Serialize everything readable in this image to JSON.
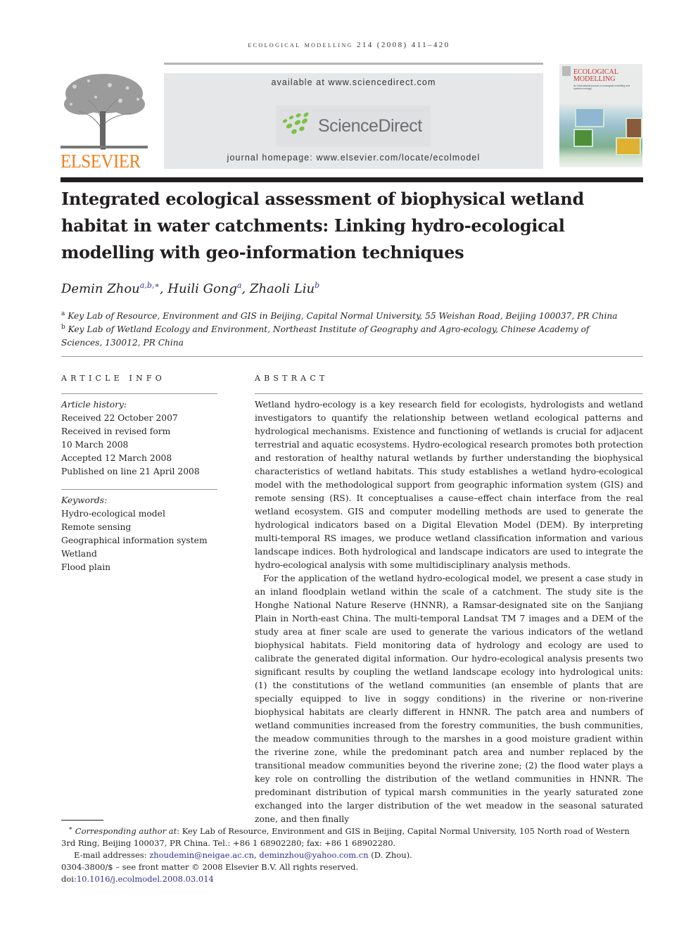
{
  "running_head": "ecological modelling 214 (2008) 411–420",
  "banner": {
    "available_at": "available at www.sciencedirect.com",
    "sciencedirect_logo": "ScienceDirect",
    "journal_homepage": "journal homepage: www.elsevier.com/locate/ecolmodel"
  },
  "publisher_logo": "ELSEVIER",
  "cover": {
    "title_line1": "ECOLOGICAL",
    "title_line2": "MODELLING",
    "subtitle": "An international journal on ecological modelling and systems ecology"
  },
  "colors": {
    "elsevier_orange": "#f07f1c",
    "link_blue": "#2e3192",
    "sciencedirect_green": "#7ac143",
    "text": "#231f20"
  },
  "article": {
    "title": "Integrated ecological assessment of biophysical wetland habitat in water catchments: Linking hydro-ecological modelling with geo-information techniques",
    "authors": [
      {
        "name": "Demin Zhou",
        "sup": "a,b,∗"
      },
      {
        "name": "Huili Gong",
        "sup": "a"
      },
      {
        "name": "Zhaoli Liu",
        "sup": "b"
      }
    ],
    "affiliations": [
      {
        "mark": "a",
        "text": "Key Lab of Resource, Environment and GIS in Beijing, Capital Normal University, 55 Weishan Road, Beijing 100037, PR China"
      },
      {
        "mark": "b",
        "text": "Key Lab of Wetland Ecology and Environment, Northeast Institute of Geography and Agro-ecology, Chinese Academy of Sciences, 130012, PR China"
      }
    ]
  },
  "article_info": {
    "heading": "article info",
    "history_label": "Article history:",
    "history": [
      "Received 22 October 2007",
      "Received in revised form",
      "10 March 2008",
      "Accepted 12 March 2008",
      "Published on line 21 April 2008"
    ],
    "keywords_label": "Keywords:",
    "keywords": [
      "Hydro-ecological model",
      "Remote sensing",
      "Geographical information system",
      "Wetland",
      "Flood plain"
    ]
  },
  "abstract": {
    "heading": "abstract",
    "paragraphs": [
      "Wetland hydro-ecology is a key research field for ecologists, hydrologists and wetland investigators to quantify the relationship between wetland ecological patterns and hydrological mechanisms. Existence and functioning of wetlands is crucial for adjacent terrestrial and aquatic ecosystems. Hydro-ecological research promotes both protection and restoration of healthy natural wetlands by further understanding the biophysical characteristics of wetland habitats. This study establishes a wetland hydro-ecological model with the methodological support from geographic information system (GIS) and remote sensing (RS). It conceptualises a cause–effect chain interface from the real wetland ecosystem. GIS and computer modelling methods are used to generate the hydrological indicators based on a Digital Elevation Model (DEM). By interpreting multi-temporal RS images, we produce wetland classification information and various landscape indices. Both hydrological and landscape indicators are used to integrate the hydro-ecological analysis with some multidisciplinary analysis methods.",
      "For the application of the wetland hydro-ecological model, we present a case study in an inland floodplain wetland within the scale of a catchment. The study site is the Honghe National Nature Reserve (HNNR), a Ramsar-designated site on the Sanjiang Plain in North-east China. The multi-temporal Landsat TM 7 images and a DEM of the study area at finer scale are used to generate the various indicators of the wetland biophysical habitats. Field monitoring data of hydrology and ecology are used to calibrate the generated digital information. Our hydro-ecological analysis presents two significant results by coupling the wetland landscape ecology into hydrological units: (1) the constitutions of the wetland communities (an ensemble of plants that are specially equipped to live in soggy conditions) in the riverine or non-riverine biophysical habitats are clearly different in HNNR. The patch area and numbers of wetland communities increased from the forestry communities, the bush communities, the meadow communities through to the marshes in a good moisture gradient within the riverine zone, while the predominant patch area and number replaced by the transitional meadow communities beyond the riverine zone; (2) the flood water plays a key role on controlling the distribution of the wetland communities in HNNR. The predominant distribution of typical marsh communities in the yearly saturated zone exchanged into the larger distribution of the wet meadow in the seasonal saturated zone, and then finally"
    ]
  },
  "footnotes": {
    "corresponding_label": "Corresponding author at",
    "corresponding_mark": "∗",
    "corresponding_text": ": Key Lab of Resource, Environment and GIS in Beijing, Capital Normal University, 105 North road of Western 3rd Ring, Beijing 100037, PR China. Tel.: +86 1 68902280; fax: +86 1 68902280.",
    "email_label": "E-mail addresses: ",
    "email1": "zhoudemin@neigae.ac.cn",
    "email_sep": ", ",
    "email2": "deminzhou@yahoo.com.cn",
    "email_suffix": " (D. Zhou).",
    "copyright": "0304-3800/$ – see front matter © 2008 Elsevier B.V. All rights reserved.",
    "doi_label": "doi:",
    "doi": "10.1016/j.ecolmodel.2008.03.014"
  }
}
